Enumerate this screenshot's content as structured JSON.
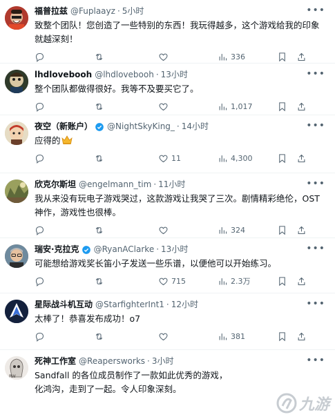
{
  "tweets": [
    {
      "name": "福普拉兹",
      "handle": "@Fuplaayz",
      "time": "5小时",
      "text": "致整个团队！您创造了一些特别的东西！我玩得越多，这个游戏给我的印象就越深刻！",
      "views": "336",
      "avatar_color": "#c0392b"
    },
    {
      "name": "lhdlovebooh",
      "handle": "@lhdlovebooh",
      "time": "13小时",
      "text": "整个团队都做得很好。我等不及要买它了。",
      "views": "1,017",
      "avatar_color": "#3d3a2e"
    },
    {
      "name": "夜空（新账户）",
      "handle": "@NightSkyKing_",
      "time": "14小时",
      "text": "应得的",
      "likes": "11",
      "views": "4,300",
      "avatar_color": "#d8c9a8",
      "emoji": "crown-emoji"
    },
    {
      "name": "欣克尔斯坦",
      "handle": "@engelmann_tim",
      "time": "11小时",
      "text": "我从来没有玩电子游戏哭过，这款游戏让我哭了三次。剧情精彩绝伦，OST 神作，游戏性也很棒。",
      "views": "324",
      "avatar_color": "#8a8f55"
    },
    {
      "name": "瑞安·克拉克",
      "handle": "@RyanAClarke",
      "time": "13小时",
      "text": "可能想给游戏奖长笛小子发送一些乐谱，以便他可以开始练习。",
      "likes": "715",
      "views": "2.3万",
      "avatar_color": "#7b5b4a"
    },
    {
      "name": "星际战斗机互动",
      "handle": "@StarfighterInt1",
      "time": "12小时",
      "text": "太棒了！恭喜发布成功！o7",
      "views": "381",
      "avatar_color": "#1d2b4f"
    },
    {
      "name": "死神工作室",
      "handle": "@Reapersworks",
      "time": "3小时",
      "text": "Sandfall 的各位成员制作了一款如此优秀的游戏，",
      "text2": "化鸿沟，走到了一起。令人印象深刻。",
      "avatar_color": "#e8e4e0"
    }
  ],
  "watermark": {
    "text": "九游",
    "icon": "jiuyou-logo-icon"
  },
  "colors": {
    "verified": "#1d9bf0",
    "muted": "#536471",
    "text": "#0f1419"
  }
}
